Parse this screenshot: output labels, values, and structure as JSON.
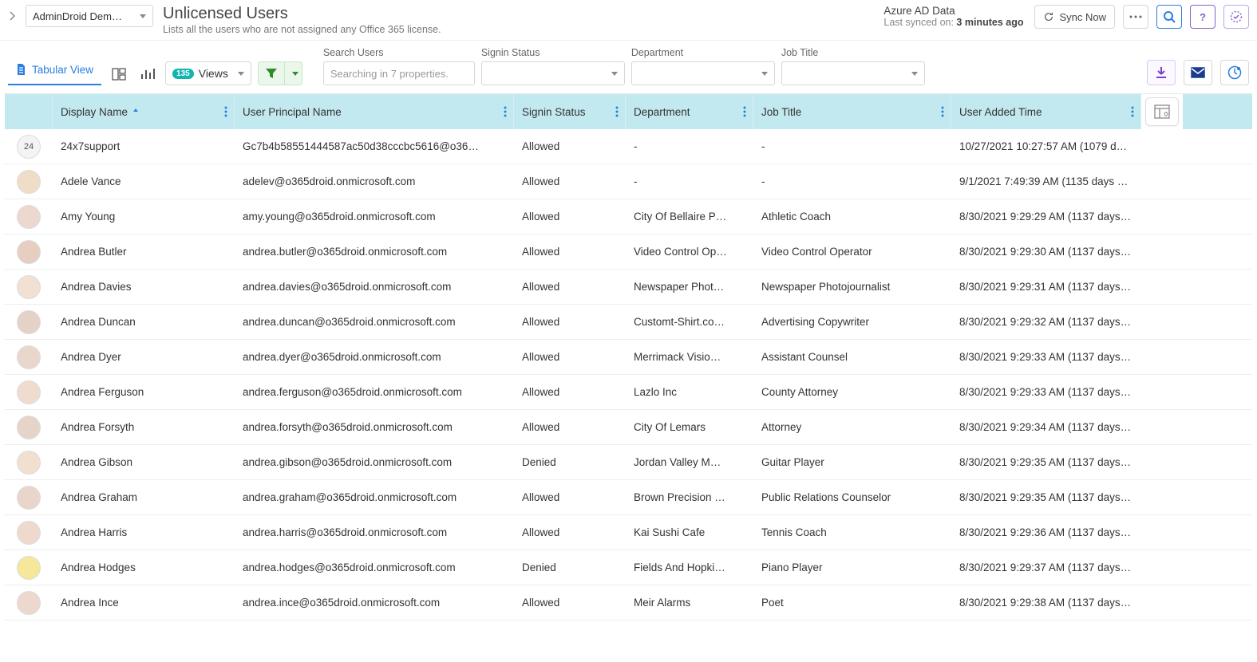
{
  "header": {
    "tenant_dropdown": "AdminDroid Dem…",
    "title": "Unlicensed Users",
    "subtitle": "Lists all the users who are not assigned any Office 365 license.",
    "sync_title": "Azure AD Data",
    "sync_prefix": "Last synced on: ",
    "sync_value": "3 minutes ago",
    "sync_now": "Sync Now"
  },
  "toolbar": {
    "tabular_label": "Tabular View",
    "views_count": "135",
    "views_label": "Views",
    "filter_labels": {
      "search": "Search Users",
      "signin": "Signin Status",
      "department": "Department",
      "jobtitle": "Job Title"
    },
    "search_placeholder": "Searching in 7 properties."
  },
  "table": {
    "columns": {
      "display_name": "Display Name",
      "upn": "User Principal Name",
      "signin": "Signin Status",
      "department": "Department",
      "jobtitle": "Job Title",
      "added": "User Added Time"
    },
    "rows": [
      {
        "avatar_num": "24",
        "display_name": "24x7support",
        "upn": "Gc7b4b58551444587ac50d38cccbc5616@o36…",
        "signin": "Allowed",
        "department": "-",
        "jobtitle": "-",
        "added": "10/27/2021 10:27:57 AM (1079 d…"
      },
      {
        "display_name": "Adele Vance",
        "upn": "adelev@o365droid.onmicrosoft.com",
        "signin": "Allowed",
        "department": "-",
        "jobtitle": "-",
        "added": "9/1/2021 7:49:39 AM (1135 days …"
      },
      {
        "display_name": "Amy Young",
        "upn": "amy.young@o365droid.onmicrosoft.com",
        "signin": "Allowed",
        "department": "City Of Bellaire P…",
        "jobtitle": "Athletic Coach",
        "added": "8/30/2021 9:29:29 AM (1137 days…"
      },
      {
        "display_name": "Andrea Butler",
        "upn": "andrea.butler@o365droid.onmicrosoft.com",
        "signin": "Allowed",
        "department": "Video Control Op…",
        "jobtitle": "Video Control Operator",
        "added": "8/30/2021 9:29:30 AM (1137 days…"
      },
      {
        "display_name": "Andrea Davies",
        "upn": "andrea.davies@o365droid.onmicrosoft.com",
        "signin": "Allowed",
        "department": "Newspaper Phot…",
        "jobtitle": "Newspaper Photojournalist",
        "added": "8/30/2021 9:29:31 AM (1137 days…"
      },
      {
        "display_name": "Andrea Duncan",
        "upn": "andrea.duncan@o365droid.onmicrosoft.com",
        "signin": "Allowed",
        "department": "Customt-Shirt.co…",
        "jobtitle": "Advertising Copywriter",
        "added": "8/30/2021 9:29:32 AM (1137 days…"
      },
      {
        "display_name": "Andrea Dyer",
        "upn": "andrea.dyer@o365droid.onmicrosoft.com",
        "signin": "Allowed",
        "department": "Merrimack Visio…",
        "jobtitle": "Assistant Counsel",
        "added": "8/30/2021 9:29:33 AM (1137 days…"
      },
      {
        "display_name": "Andrea Ferguson",
        "upn": "andrea.ferguson@o365droid.onmicrosoft.com",
        "signin": "Allowed",
        "department": "Lazlo Inc",
        "jobtitle": "County Attorney",
        "added": "8/30/2021 9:29:33 AM (1137 days…"
      },
      {
        "display_name": "Andrea Forsyth",
        "upn": "andrea.forsyth@o365droid.onmicrosoft.com",
        "signin": "Allowed",
        "department": "City Of Lemars",
        "jobtitle": "Attorney",
        "added": "8/30/2021 9:29:34 AM (1137 days…"
      },
      {
        "display_name": "Andrea Gibson",
        "upn": "andrea.gibson@o365droid.onmicrosoft.com",
        "signin": "Denied",
        "department": "Jordan Valley M…",
        "jobtitle": "Guitar Player",
        "added": "8/30/2021 9:29:35 AM (1137 days…"
      },
      {
        "display_name": "Andrea Graham",
        "upn": "andrea.graham@o365droid.onmicrosoft.com",
        "signin": "Allowed",
        "department": "Brown Precision …",
        "jobtitle": "Public Relations Counselor",
        "added": "8/30/2021 9:29:35 AM (1137 days…"
      },
      {
        "display_name": "Andrea Harris",
        "upn": "andrea.harris@o365droid.onmicrosoft.com",
        "signin": "Allowed",
        "department": "Kai Sushi Cafe",
        "jobtitle": "Tennis Coach",
        "added": "8/30/2021 9:29:36 AM (1137 days…"
      },
      {
        "display_name": "Andrea Hodges",
        "upn": "andrea.hodges@o365droid.onmicrosoft.com",
        "signin": "Denied",
        "department": "Fields And Hopki…",
        "jobtitle": "Piano Player",
        "added": "8/30/2021 9:29:37 AM (1137 days…"
      },
      {
        "display_name": "Andrea Ince",
        "upn": "andrea.ince@o365droid.onmicrosoft.com",
        "signin": "Allowed",
        "department": "Meir Alarms",
        "jobtitle": "Poet",
        "added": "8/30/2021 9:29:38 AM (1137 days…"
      }
    ]
  }
}
